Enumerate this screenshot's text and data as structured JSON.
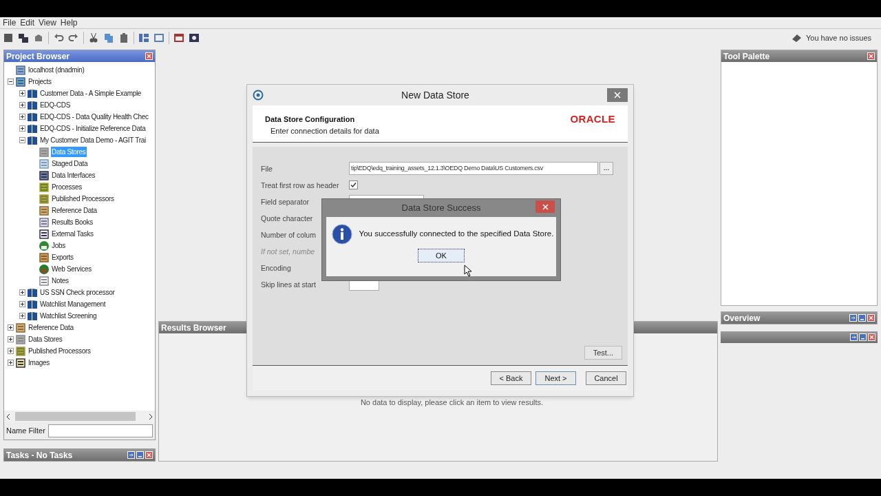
{
  "menu": [
    "File",
    "Edit",
    "View",
    "Help"
  ],
  "status": {
    "text": "You have no issues"
  },
  "project_browser": {
    "title": "Project Browser",
    "active": true,
    "tree": [
      {
        "label": "localhost (dnadmin)",
        "kind": "server",
        "selected": false
      },
      {
        "label": "Projects",
        "kind": "projects",
        "selected": false,
        "expanded": true,
        "children": [
          {
            "label": "Customer Data - A Simple Example",
            "kind": "project",
            "selected": false,
            "expanded": false
          },
          {
            "label": "EDQ-CDS",
            "kind": "project",
            "selected": false,
            "expanded": false
          },
          {
            "label": "EDQ-CDS - Data Quality Health Chec",
            "kind": "project",
            "selected": false,
            "expanded": false
          },
          {
            "label": "EDQ-CDS - Initialize Reference Data",
            "kind": "project",
            "selected": false,
            "expanded": false
          },
          {
            "label": "My Customer Data Demo - AGIT Trai",
            "kind": "project",
            "selected": false,
            "expanded": true,
            "children": [
              {
                "label": "Data Stores",
                "kind": "datastores",
                "selected": true
              },
              {
                "label": "Staged Data",
                "kind": "staged",
                "selected": false
              },
              {
                "label": "Data Interfaces",
                "kind": "interfaces",
                "selected": false
              },
              {
                "label": "Processes",
                "kind": "processes",
                "selected": false
              },
              {
                "label": "Published Processors",
                "kind": "published",
                "selected": false
              },
              {
                "label": "Reference Data",
                "kind": "refdata",
                "selected": false
              },
              {
                "label": "Results Books",
                "kind": "results",
                "selected": false
              },
              {
                "label": "External Tasks",
                "kind": "external",
                "selected": false
              },
              {
                "label": "Jobs",
                "kind": "jobs",
                "selected": false
              },
              {
                "label": "Exports",
                "kind": "exports",
                "selected": false
              },
              {
                "label": "Web Services",
                "kind": "webservices",
                "selected": false
              },
              {
                "label": "Notes",
                "kind": "notes",
                "selected": false
              }
            ]
          },
          {
            "label": "US SSN Check processor",
            "kind": "project",
            "selected": false,
            "expanded": false
          },
          {
            "label": "Watchlist Management",
            "kind": "project",
            "selected": false,
            "expanded": false
          },
          {
            "label": "Watchlist Screening",
            "kind": "project",
            "selected": false,
            "expanded": false
          }
        ]
      },
      {
        "label": "Reference Data",
        "kind": "refdata",
        "selected": false,
        "expanded": false
      },
      {
        "label": "Data Stores",
        "kind": "datastores",
        "selected": false,
        "expanded": false
      },
      {
        "label": "Published Processors",
        "kind": "published",
        "selected": false,
        "expanded": false
      },
      {
        "label": "Images",
        "kind": "images",
        "selected": false,
        "expanded": false
      }
    ],
    "name_filter": {
      "label": "Name Filter"
    }
  },
  "tasks": {
    "title": "Tasks - No Tasks",
    "active": false
  },
  "tool_palette": {
    "title": "Tool Palette",
    "active": false
  },
  "overview": {
    "title": "Overview",
    "active": false
  },
  "results_browser": {
    "title": "Results Browser",
    "active": false,
    "empty_message": "No data to display, please click an item to view results."
  },
  "dialog": {
    "title": "New Data Store",
    "header_title": "Data Store Configuration",
    "header_subtitle": "Enter connection details for data",
    "logo": "ORACLE",
    "rows": [
      {
        "kind": "file",
        "label": "File",
        "value": "tip\\EDQ\\edq_training_assets_12.1.3\\OEDQ Demo Data\\US Customers.csv",
        "button": "..."
      },
      {
        "kind": "checkbox",
        "label": "Treat first row as header",
        "checked": true
      },
      {
        "kind": "field",
        "label": "Field separator"
      },
      {
        "kind": "label",
        "label": "Quote character"
      },
      {
        "kind": "label",
        "label": "Number of colum"
      },
      {
        "kind": "hint",
        "label": "If not set, numbe"
      },
      {
        "kind": "label",
        "label": "Encoding"
      },
      {
        "kind": "short",
        "label": "Skip lines at start"
      }
    ],
    "test_button": "Test...",
    "buttons": [
      "< Back",
      "Next >",
      "Cancel"
    ]
  },
  "message_box": {
    "title": "Data Store Success",
    "message": "You successfully connected to the specified Data Store.",
    "ok": "OK"
  }
}
